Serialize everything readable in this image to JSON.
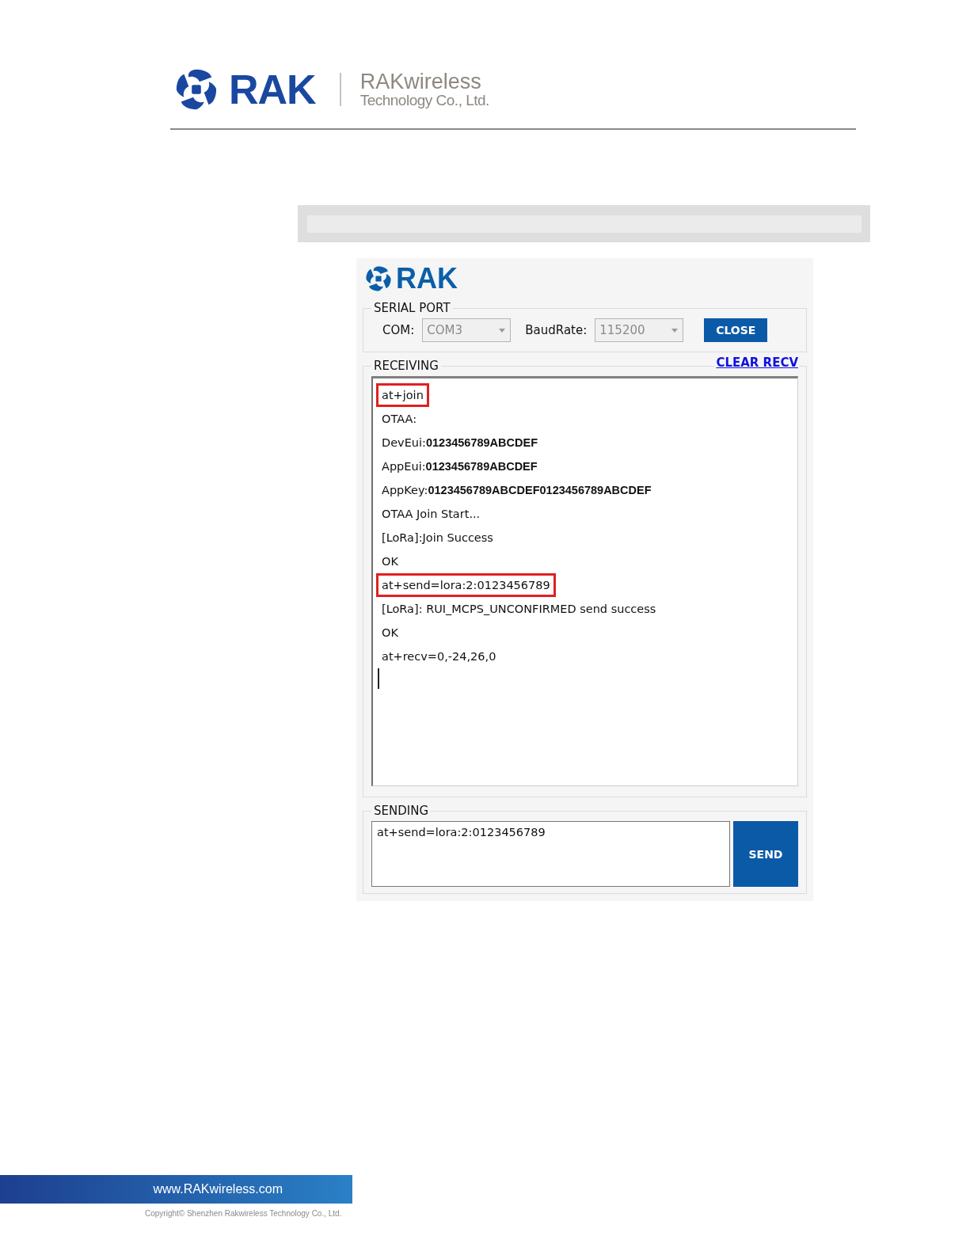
{
  "header": {
    "logo_text": "RAK",
    "company_name": "RAKwireless",
    "company_sub": "Technology Co., Ltd."
  },
  "app": {
    "logo_text": "RAK",
    "serial_port": {
      "title": "SERIAL PORT",
      "com_label": "COM:",
      "com_value": "COM3",
      "baud_label": "BaudRate:",
      "baud_value": "115200",
      "disabled": true,
      "button": "CLOSE"
    },
    "receiving": {
      "title": "RECEIVING",
      "clear_link": "CLEAR RECV",
      "lines": [
        {
          "text": "at+join",
          "highlighted": true
        },
        {
          "text": "OTAA:",
          "highlighted": false
        },
        {
          "text": "DevEui:**0123456789ABCDEF**",
          "highlighted": false
        },
        {
          "text": "AppEui:**0123456789ABCDEF**",
          "highlighted": false
        },
        {
          "text": "AppKey:**0123456789ABCDEF0123456789ABCDEF**",
          "highlighted": false
        },
        {
          "text": "OTAA Join Start...",
          "highlighted": false
        },
        {
          "text": "[LoRa]:Join Success",
          "highlighted": false
        },
        {
          "text": "OK",
          "highlighted": false
        },
        {
          "text": "at+send=lora:2:0123456789",
          "highlighted": true
        },
        {
          "text": "[LoRa]: RUI_MCPS_UNCONFIRMED send success",
          "highlighted": false
        },
        {
          "text": "OK",
          "highlighted": false
        },
        {
          "text": "at+recv=0,-24,26,0",
          "highlighted": false
        }
      ]
    },
    "sending": {
      "title": "SENDING",
      "value": "at+send=lora:2:0123456789",
      "button": "SEND"
    }
  },
  "footer": {
    "url": "www.RAKwireless.com",
    "copyright": "Copyright© Shenzhen Rakwireless Technology Co., Ltd."
  }
}
